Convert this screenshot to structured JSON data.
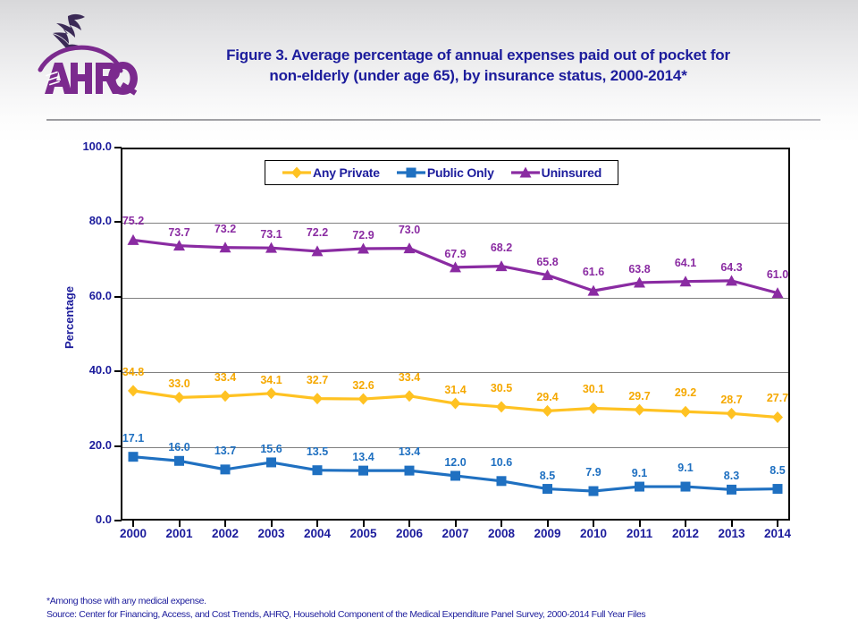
{
  "header": {
    "logo_alt": "AHRQ Agency for Healthcare Research and Quality",
    "title_line1": "Figure 3. Average percentage of annual expenses paid out of pocket for",
    "title_line2": "non-elderly (under age 65), by insurance status, 2000-2014*"
  },
  "colors": {
    "any_private": "#FFC222",
    "any_private_label": "#F5A800",
    "public_only": "#1F70C1",
    "uninsured": "#8A2BA2",
    "text_blue": "#1c1c9c",
    "axis_black": "#000000",
    "gridline": "#808080"
  },
  "legend": {
    "items": [
      {
        "label": "Any Private",
        "marker": "diamond-marker",
        "color": "#FFC222"
      },
      {
        "label": "Public Only",
        "marker": "square-marker",
        "color": "#1F70C1"
      },
      {
        "label": "Uninsured",
        "marker": "triangle-marker",
        "color": "#8A2BA2"
      }
    ]
  },
  "footnotes": {
    "line1": "*Among those with any medical expense.",
    "line2": "Source: Center for Financing, Access, and Cost Trends, AHRQ, Household Component of the Medical Expenditure Panel Survey,  2000-2014 Full Year Files"
  },
  "chart_data": {
    "type": "line",
    "title": "Figure 3. Average percentage of annual expenses paid out of pocket for non-elderly (under age 65), by insurance status, 2000-2014*",
    "xlabel": "",
    "ylabel": "Percentage",
    "ylim": [
      0.0,
      100.0
    ],
    "ytick_labels": [
      "0.0",
      "20.0",
      "40.0",
      "60.0",
      "80.0",
      "100.0"
    ],
    "ytick_values": [
      0,
      20,
      40,
      60,
      80,
      100
    ],
    "grid": true,
    "legend_position": "top-center-inside",
    "categories": [
      "2000",
      "2001",
      "2002",
      "2003",
      "2004",
      "2005",
      "2006",
      "2007",
      "2008",
      "2009",
      "2010",
      "2011",
      "2012",
      "2013",
      "2014"
    ],
    "series": [
      {
        "name": "Any Private",
        "color": "#FFC222",
        "marker": "diamond",
        "values": [
          34.8,
          33.0,
          33.4,
          34.1,
          32.7,
          32.6,
          33.4,
          31.4,
          30.5,
          29.4,
          30.1,
          29.7,
          29.2,
          28.7,
          27.7
        ],
        "labels": [
          "34.8",
          "33.0",
          "33.4",
          "34.1",
          "32.7",
          "32.6",
          "33.4",
          "31.4",
          "30.5",
          "29.4",
          "30.1",
          "29.7",
          "29.2",
          "28.7",
          "27.7"
        ]
      },
      {
        "name": "Public Only",
        "color": "#1F70C1",
        "marker": "square",
        "values": [
          17.1,
          16.0,
          13.7,
          15.6,
          13.5,
          13.4,
          13.4,
          12.0,
          10.6,
          8.5,
          7.9,
          9.1,
          9.1,
          8.3,
          8.5
        ],
        "labels": [
          "17.1",
          "16.0",
          "13.7",
          "15.6",
          "13.5",
          "13.4",
          "13.4",
          "12.0",
          "10.6",
          "8.5",
          "7.9",
          "9.1",
          "9.1",
          "8.3",
          "8.5"
        ]
      },
      {
        "name": "Uninsured",
        "color": "#8A2BA2",
        "marker": "triangle",
        "values": [
          75.2,
          73.7,
          73.2,
          73.1,
          72.2,
          72.9,
          73.0,
          67.9,
          68.2,
          65.8,
          61.6,
          63.8,
          64.1,
          64.3,
          61.0
        ],
        "labels": [
          "75.2",
          "73.7",
          "73.2",
          "73.1",
          "72.2",
          "72.9",
          "73.0",
          "67.9",
          "68.2",
          "65.8",
          "61.6",
          "63.8",
          "64.1",
          "64.3",
          "61.0"
        ]
      }
    ]
  }
}
